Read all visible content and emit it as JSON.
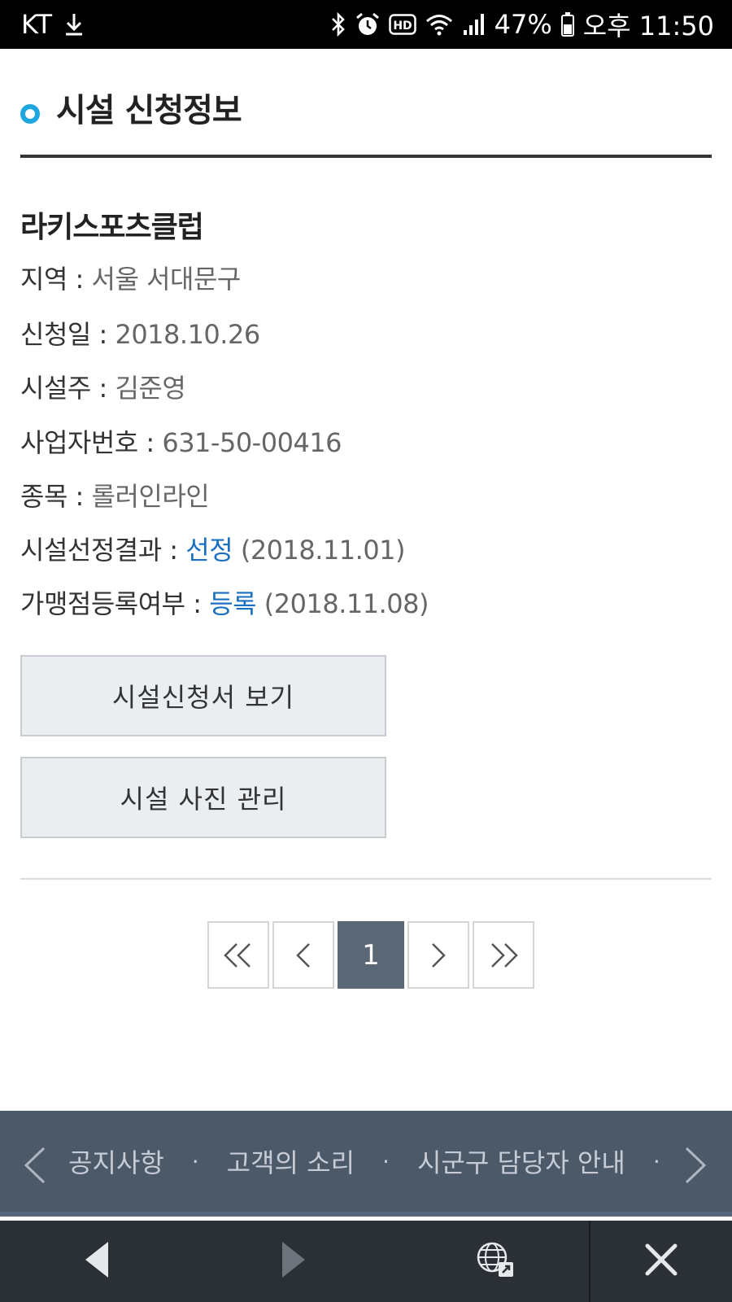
{
  "status_bar": {
    "carrier": "KT",
    "battery_percent": "47%",
    "time": "오후 11:50",
    "icons": [
      "download-icon",
      "bluetooth-icon",
      "alarm-icon",
      "hd-icon",
      "wifi-icon",
      "signal-icon",
      "battery-icon"
    ]
  },
  "page": {
    "title": "시설 신청정보",
    "accent_color": "#1ea6e0"
  },
  "facility": {
    "name": "라키스포츠클럽",
    "fields": [
      {
        "label": "지역 : ",
        "value": "서울 서대문구"
      },
      {
        "label": "신청일 : ",
        "value": "2018.10.26"
      },
      {
        "label": "시설주 : ",
        "value": "김준영"
      },
      {
        "label": "사업자번호 : ",
        "value": "631-50-00416"
      },
      {
        "label": "종목 : ",
        "value": "롤러인라인"
      },
      {
        "label": "시설선정결과 : ",
        "status": "선정",
        "date": " (2018.11.01)"
      },
      {
        "label": "가맹점등록여부 : ",
        "status": "등록",
        "date": " (2018.11.08)"
      }
    ],
    "link_color": "#1a6fc0"
  },
  "buttons": {
    "view_application": "시설신청서 보기",
    "manage_photos": "시설 사진 관리"
  },
  "pagination": {
    "current_page": "1",
    "icons": [
      "double-chevron-left-icon",
      "chevron-left-icon",
      "chevron-right-icon",
      "double-chevron-right-icon"
    ]
  },
  "footer_nav": {
    "links": [
      "공지사항",
      "고객의 소리",
      "시군구 담당자 안내"
    ],
    "separator": "·"
  },
  "browser_bar": {
    "icons": [
      "back-icon",
      "forward-icon",
      "globe-icon",
      "close-icon"
    ]
  }
}
